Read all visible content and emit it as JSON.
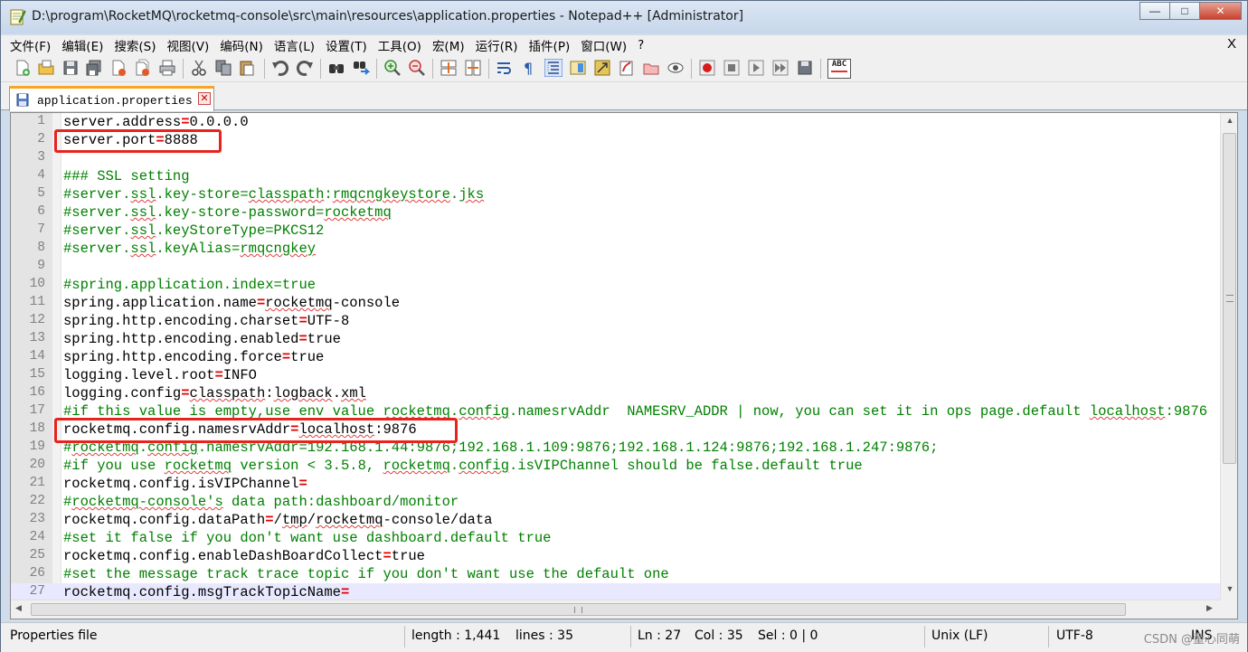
{
  "window": {
    "title": "D:\\program\\RocketMQ\\rocketmq-console\\src\\main\\resources\\application.properties - Notepad++ [Administrator]",
    "minimize_glyph": "—",
    "maximize_glyph": "□",
    "close_glyph": "✕"
  },
  "menu": {
    "items": [
      "文件(F)",
      "编辑(E)",
      "搜索(S)",
      "视图(V)",
      "编码(N)",
      "语言(L)",
      "设置(T)",
      "工具(O)",
      "宏(M)",
      "运行(R)",
      "插件(P)",
      "窗口(W)",
      "?"
    ],
    "close_label": "X"
  },
  "toolbar": {
    "icons": [
      "new-file-icon",
      "open-file-icon",
      "save-icon",
      "save-all-icon",
      "close-icon",
      "close-all-icon",
      "print-icon",
      "cut-icon",
      "copy-icon",
      "paste-icon",
      "undo-icon",
      "redo-icon",
      "find-icon",
      "replace-icon",
      "zoom-in-icon",
      "zoom-out-icon",
      "sync-vertical-icon",
      "sync-horizontal-icon",
      "word-wrap-icon",
      "show-all-chars-icon",
      "indent-guide-icon",
      "doc-map-icon",
      "function-list-icon",
      "folder-workspace-icon",
      "monitor-icon",
      "eye-icon",
      "record-macro-icon",
      "stop-record-icon",
      "play-macro-icon",
      "run-macro-multiple-icon",
      "save-macro-icon",
      "spell-check-icon"
    ],
    "spellcheck_label": "ABC"
  },
  "tab": {
    "label": "application.properties",
    "close_glyph": "✕"
  },
  "editor": {
    "lines": [
      {
        "n": "1",
        "segments": [
          [
            "k",
            "server.address"
          ],
          [
            "o",
            "="
          ],
          [
            "v",
            "0.0.0.0"
          ]
        ]
      },
      {
        "n": "2",
        "segments": [
          [
            "k",
            "server.port"
          ],
          [
            "o",
            "="
          ],
          [
            "v",
            "8888"
          ]
        ]
      },
      {
        "n": "3",
        "segments": []
      },
      {
        "n": "4",
        "segments": [
          [
            "c",
            "### SSL setting"
          ]
        ]
      },
      {
        "n": "5",
        "segments": [
          [
            "c",
            "#server."
          ],
          [
            "cs",
            "ssl"
          ],
          [
            "c",
            "."
          ],
          [
            "c",
            "key-store="
          ],
          [
            "cs",
            "classpath"
          ],
          [
            "c",
            ":"
          ],
          [
            "cs",
            "rmqcngkeystore"
          ],
          [
            "c",
            "."
          ],
          [
            "cs",
            "jks"
          ]
        ]
      },
      {
        "n": "6",
        "segments": [
          [
            "c",
            "#server."
          ],
          [
            "cs",
            "ssl"
          ],
          [
            "c",
            ".key-store-password="
          ],
          [
            "cs",
            "rocketmq"
          ]
        ]
      },
      {
        "n": "7",
        "segments": [
          [
            "c",
            "#server."
          ],
          [
            "cs",
            "ssl"
          ],
          [
            "c",
            ".keyStoreType=PKCS12"
          ]
        ]
      },
      {
        "n": "8",
        "segments": [
          [
            "c",
            "#server."
          ],
          [
            "cs",
            "ssl"
          ],
          [
            "c",
            ".keyAlias="
          ],
          [
            "cs",
            "rmqcngkey"
          ]
        ]
      },
      {
        "n": "9",
        "segments": []
      },
      {
        "n": "10",
        "segments": [
          [
            "c",
            "#spring.application.index=true"
          ]
        ]
      },
      {
        "n": "11",
        "segments": [
          [
            "k",
            "spring.application.name"
          ],
          [
            "o",
            "="
          ],
          [
            "vs",
            "rocketmq"
          ],
          [
            "v",
            "-console"
          ]
        ]
      },
      {
        "n": "12",
        "segments": [
          [
            "k",
            "spring.http.encoding.charset"
          ],
          [
            "o",
            "="
          ],
          [
            "v",
            "UTF-8"
          ]
        ]
      },
      {
        "n": "13",
        "segments": [
          [
            "k",
            "spring.http.encoding.enabled"
          ],
          [
            "o",
            "="
          ],
          [
            "v",
            "true"
          ]
        ]
      },
      {
        "n": "14",
        "segments": [
          [
            "k",
            "spring.http.encoding.force"
          ],
          [
            "o",
            "="
          ],
          [
            "v",
            "true"
          ]
        ]
      },
      {
        "n": "15",
        "segments": [
          [
            "k",
            "logging.level.root"
          ],
          [
            "o",
            "="
          ],
          [
            "v",
            "INFO"
          ]
        ]
      },
      {
        "n": "16",
        "segments": [
          [
            "k",
            "logging.config"
          ],
          [
            "o",
            "="
          ],
          [
            "vs",
            "classpath"
          ],
          [
            "v",
            ":"
          ],
          [
            "vs",
            "logback"
          ],
          [
            "v",
            "."
          ],
          [
            "vs",
            "xml"
          ]
        ]
      },
      {
        "n": "17",
        "segments": [
          [
            "c",
            "#if this value is empty,use env value "
          ],
          [
            "cs",
            "rocketmq"
          ],
          [
            "c",
            "."
          ],
          [
            "cs",
            "config"
          ],
          [
            "c",
            ".namesrvAddr  NAMESRV_ADDR | now, you can set it in ops page.default "
          ],
          [
            "cs",
            "localhost"
          ],
          [
            "c",
            ":9876"
          ]
        ]
      },
      {
        "n": "18",
        "segments": [
          [
            "k",
            "rocketmq.config.namesrvAddr"
          ],
          [
            "o",
            "="
          ],
          [
            "vs",
            "localhost"
          ],
          [
            "v",
            ":9876"
          ]
        ]
      },
      {
        "n": "19",
        "segments": [
          [
            "c",
            "#"
          ],
          [
            "cs",
            "rocketmq"
          ],
          [
            "c",
            "."
          ],
          [
            "cs",
            "config"
          ],
          [
            "c",
            ".namesrvAddr=192.168.1.44:9876;192.168.1.109:9876;192.168.1.124:9876;192.168.1.247:9876;"
          ]
        ]
      },
      {
        "n": "20",
        "segments": [
          [
            "c",
            "#if you use "
          ],
          [
            "cs",
            "rocketmq"
          ],
          [
            "c",
            " version < 3.5.8, "
          ],
          [
            "cs",
            "rocketmq"
          ],
          [
            "c",
            "."
          ],
          [
            "cs",
            "config"
          ],
          [
            "c",
            ".isVIPChannel should be false.default true"
          ]
        ]
      },
      {
        "n": "21",
        "segments": [
          [
            "k",
            "rocketmq.config.isVIPChannel"
          ],
          [
            "o",
            "="
          ]
        ]
      },
      {
        "n": "22",
        "segments": [
          [
            "c",
            "#"
          ],
          [
            "cs",
            "rocketmq-console's"
          ],
          [
            "c",
            " data path:dashboard/monitor"
          ]
        ]
      },
      {
        "n": "23",
        "segments": [
          [
            "k",
            "rocketmq.config.dataPath"
          ],
          [
            "o",
            "="
          ],
          [
            "v",
            "/"
          ],
          [
            "vs",
            "tmp"
          ],
          [
            "v",
            "/"
          ],
          [
            "vs",
            "rocketmq"
          ],
          [
            "v",
            "-console/data"
          ]
        ]
      },
      {
        "n": "24",
        "segments": [
          [
            "c",
            "#set it false if you don't want use dashboard.default true"
          ]
        ]
      },
      {
        "n": "25",
        "segments": [
          [
            "k",
            "rocketmq.config.enableDashBoardCollect"
          ],
          [
            "o",
            "="
          ],
          [
            "v",
            "true"
          ]
        ]
      },
      {
        "n": "26",
        "segments": [
          [
            "c",
            "#set the message track trace topic if you don't want use the default one"
          ]
        ]
      },
      {
        "n": "27",
        "segments": [
          [
            "k",
            "rocketmq.config.msgTrackTopicName"
          ],
          [
            "o",
            "="
          ]
        ],
        "current": true
      }
    ],
    "scroll": {
      "up": "▲",
      "down": "▼",
      "left": "◀",
      "right": "▶",
      "grip_v": "≡",
      "grip_h": "|||"
    }
  },
  "status": {
    "file_type": "Properties file",
    "length": "length : 1,441",
    "lines": "lines : 35",
    "position": "Ln : 27",
    "column": "Col : 35",
    "selection": "Sel : 0 | 0",
    "eol": "Unix (LF)",
    "encoding": "UTF-8",
    "mode": "INS",
    "watermark": "CSDN @童心同萌"
  },
  "colors": {
    "comment": "#008000",
    "operator": "#e00000",
    "highlight_box": "#e8231d",
    "current_line": "#e8e8ff",
    "tab_accent": "#f5a623"
  }
}
